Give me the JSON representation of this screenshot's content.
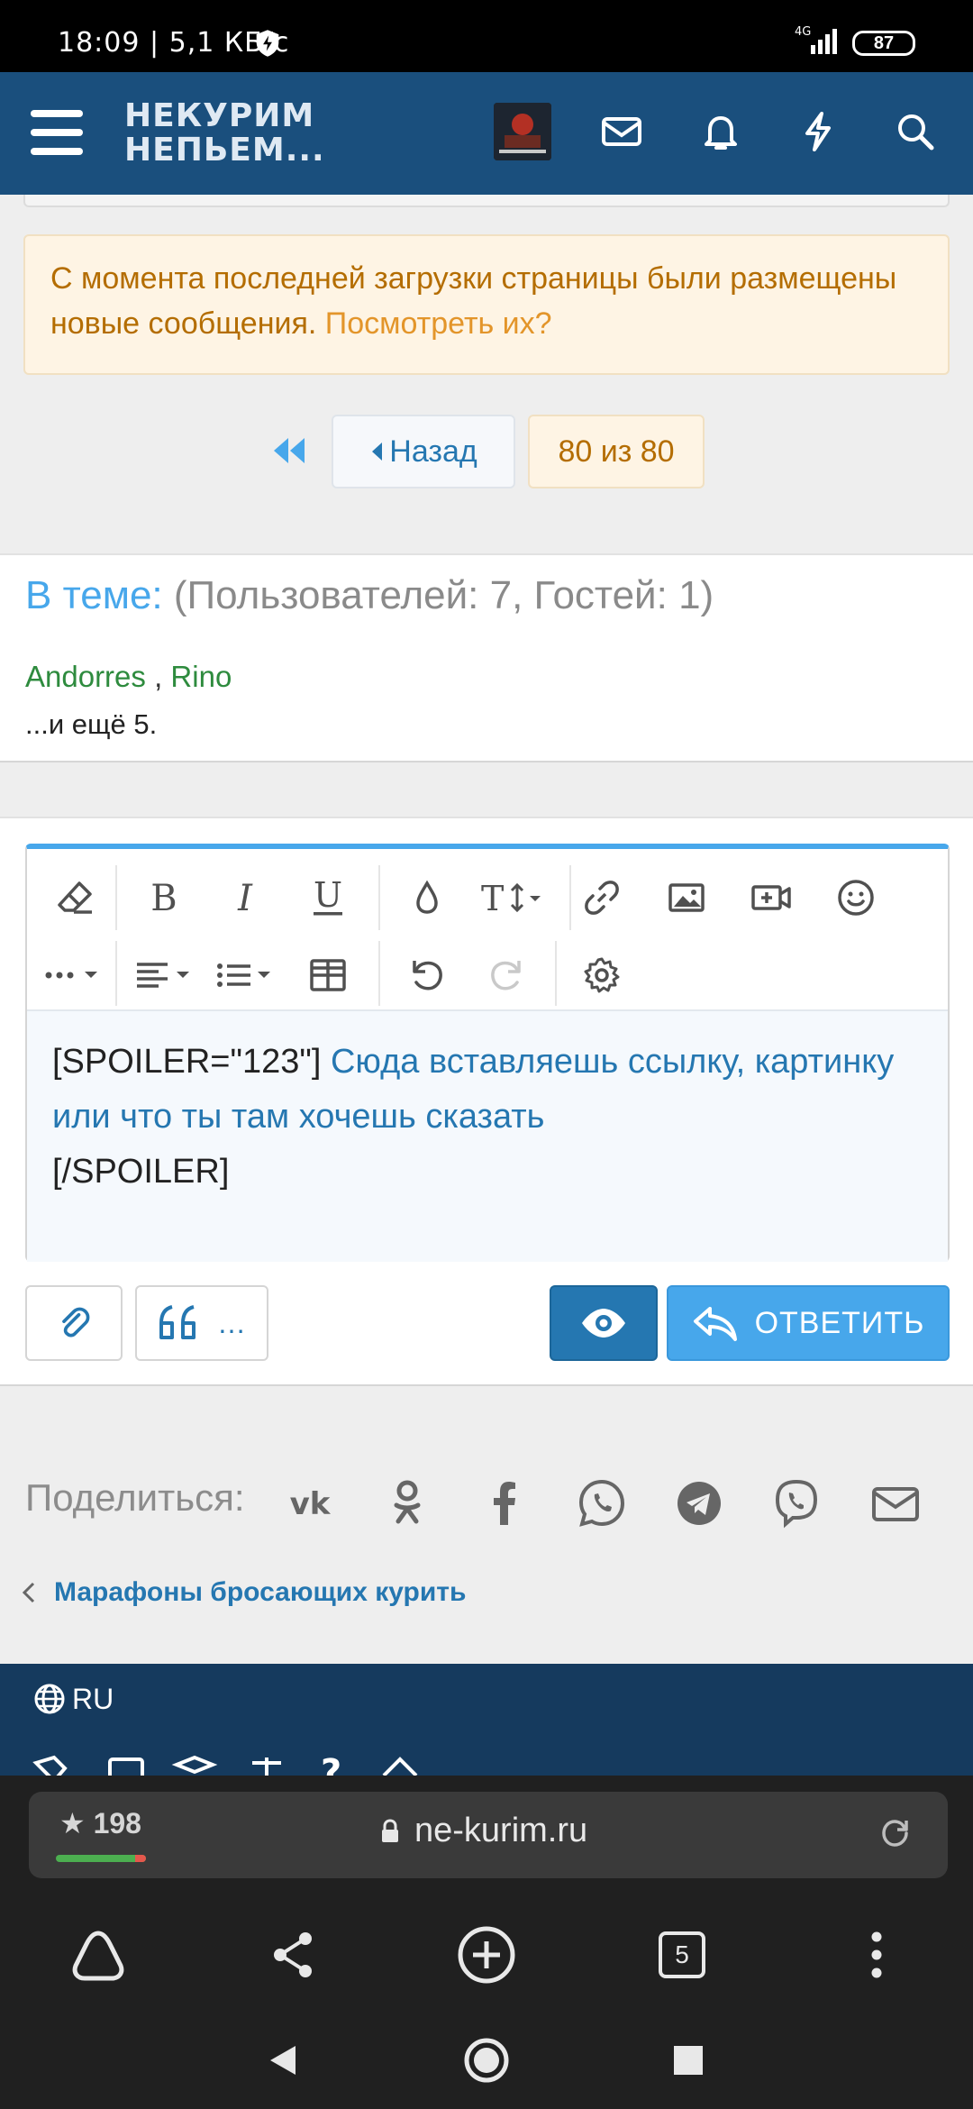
{
  "status_bar": {
    "time": "18:09 | 5,1 КБ/с",
    "network": "4G",
    "battery": "87"
  },
  "header": {
    "brand_line1": "НЕКУРИМ",
    "brand_line2": "НЕПЬЕМ..."
  },
  "notice": {
    "text": "С момента последней загрузки страницы были размещены новые сообщения. ",
    "link": "Посмотреть их?"
  },
  "pager": {
    "back_label": "Назад",
    "current": "80 из 80"
  },
  "online": {
    "label": "В теме:",
    "counts": " (Пользователей: 7, Гостей: 1)",
    "users": [
      "Andorres",
      "Rino"
    ],
    "separator": " , ",
    "more": "...и ещё 5."
  },
  "editor": {
    "text_open": "[SPOILER=\"123\"] ",
    "text_body": "Сюда вставляешь ссылку, картинку или что ты там хочешь сказать",
    "text_close": "[/SPOILER]"
  },
  "reply_bar": {
    "quote_more": "…",
    "reply_label": "ОТВЕТИТЬ"
  },
  "share": {
    "label": "Поделиться:"
  },
  "breadcrumb": {
    "label": "Марафоны бросающих курить"
  },
  "footer": {
    "language": "RU"
  },
  "browser": {
    "score": "198",
    "url": "ne-kurim.ru",
    "tabs_count": "5"
  },
  "colors": {
    "header_bg": "#1a4f7d",
    "accent": "#47a7eb",
    "link": "#2577b1",
    "notice_text": "#b46d00",
    "user_green": "#2e8b3e",
    "footer_bg": "#153a5e"
  }
}
